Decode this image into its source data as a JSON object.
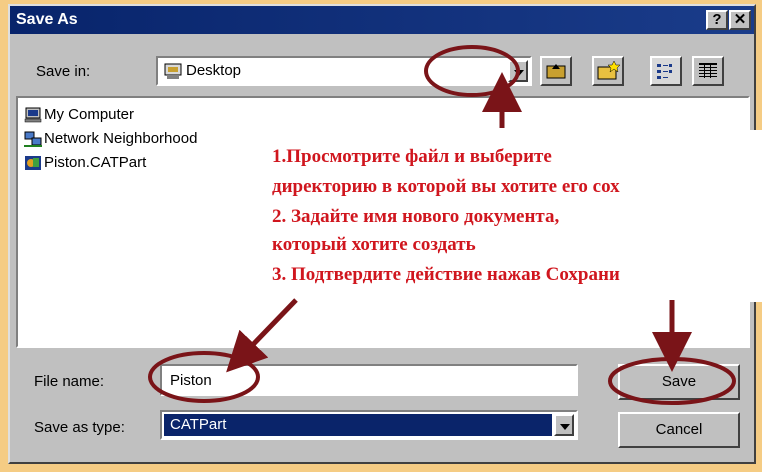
{
  "window": {
    "title": "Save As",
    "help_button": "?",
    "close_button": "✕"
  },
  "save_in": {
    "label": "Save in:",
    "value": "Desktop"
  },
  "files": [
    {
      "name": "My Computer",
      "icon": "computer-icon"
    },
    {
      "name": "Network Neighborhood",
      "icon": "network-icon"
    },
    {
      "name": "Piston.CATPart",
      "icon": "catpart-icon"
    }
  ],
  "file_name": {
    "label": "File name:",
    "value": "Piston"
  },
  "save_as_type": {
    "label": "Save as type:",
    "value": "CATPart"
  },
  "buttons": {
    "save": "Save",
    "cancel": "Cancel"
  },
  "toolbar": [
    "up-folder-icon",
    "new-folder-icon",
    "list-view-icon",
    "details-view-icon"
  ],
  "annotation": {
    "lines": [
      "1.Просмотрите файл и выберите",
      "директорию в которой вы хотите его сох",
      "2. Задайте имя нового документа,",
      " который хотите создать",
      "3. Подтвердите действие нажав Сохрани"
    ]
  },
  "colors": {
    "background": "#f5cc84",
    "titlebar": "#08246b",
    "annotation": "#d0161e",
    "highlight": "#0a246a"
  }
}
